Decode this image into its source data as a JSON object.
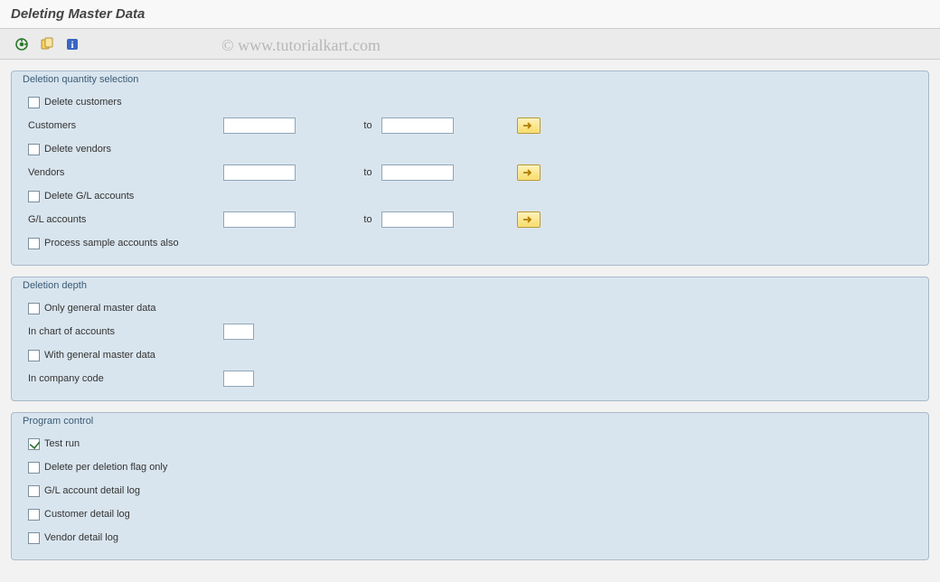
{
  "header": {
    "title": "Deleting Master Data"
  },
  "watermark": "© www.tutorialkart.com",
  "toolbar": {
    "execute": "execute",
    "variant": "variant",
    "info": "info"
  },
  "group1": {
    "title": "Deletion quantity selection",
    "delete_customers": "Delete customers",
    "customers_label": "Customers",
    "delete_vendors": "Delete vendors",
    "vendors_label": "Vendors",
    "delete_gl": "Delete G/L accounts",
    "gl_label": "G/L accounts",
    "sample": "Process sample accounts also",
    "to": "to",
    "customers_from": "",
    "customers_to": "",
    "vendors_from": "",
    "vendors_to": "",
    "gl_from": "",
    "gl_to": ""
  },
  "group2": {
    "title": "Deletion depth",
    "only_general": "Only general master data",
    "in_coa": "In chart of accounts",
    "with_general": "With general master data",
    "in_cc": "In company code",
    "coa_val": "",
    "cc_val": ""
  },
  "group3": {
    "title": "Program control",
    "test_run": "Test run",
    "test_run_checked": true,
    "per_flag": "Delete per deletion flag only",
    "gl_log": "G/L account detail log",
    "cust_log": "Customer detail log",
    "vend_log": "Vendor detail log"
  }
}
